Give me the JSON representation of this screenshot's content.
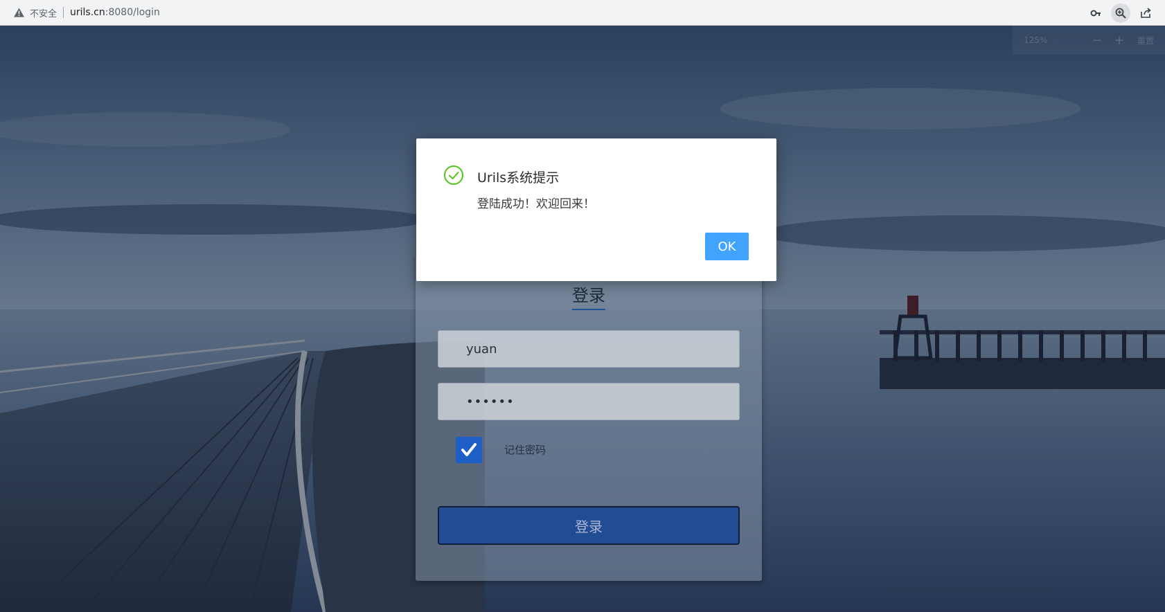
{
  "browser": {
    "security_label": "不安全",
    "url_host": "urils.cn",
    "url_path": ":8080/login"
  },
  "zoom_popup": {
    "level": "125%",
    "minus": "−",
    "plus": "+",
    "reset": "重置"
  },
  "login": {
    "title": "登录",
    "username_value": "yuan",
    "password_value": "••••••",
    "remember_checked": true,
    "remember_label": "记住密码",
    "submit_label": "登录"
  },
  "dialog": {
    "title": "Urils系统提示",
    "message": "登陆成功！欢迎回来！",
    "ok_label": "OK"
  },
  "colors": {
    "primary_button": "#40a4ff",
    "success": "#52c41a",
    "login_button": "#224c93",
    "checkbox": "#1e5fc6"
  }
}
